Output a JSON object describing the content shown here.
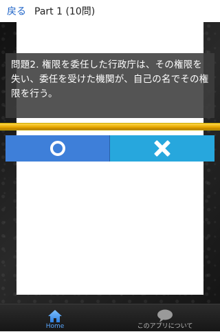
{
  "header": {
    "back_label": "戻る",
    "title": "Part 1 (10問)"
  },
  "question": {
    "text": "問題2. 権限を委任した行政庁は、その権限を失い、委任を受けた機関が、自己の名でその権限を行う。"
  },
  "progress": {
    "fraction": 1.0
  },
  "answers": {
    "correct_icon": "circle-icon",
    "wrong_icon": "cross-icon",
    "correct_color": "#3e7fd9",
    "wrong_color": "#27a7dd"
  },
  "tabbar": {
    "items": [
      {
        "label": "Home",
        "icon": "home-icon",
        "active": true
      },
      {
        "label": "このアプリについて",
        "icon": "speech-bubble-icon",
        "active": false
      }
    ]
  }
}
